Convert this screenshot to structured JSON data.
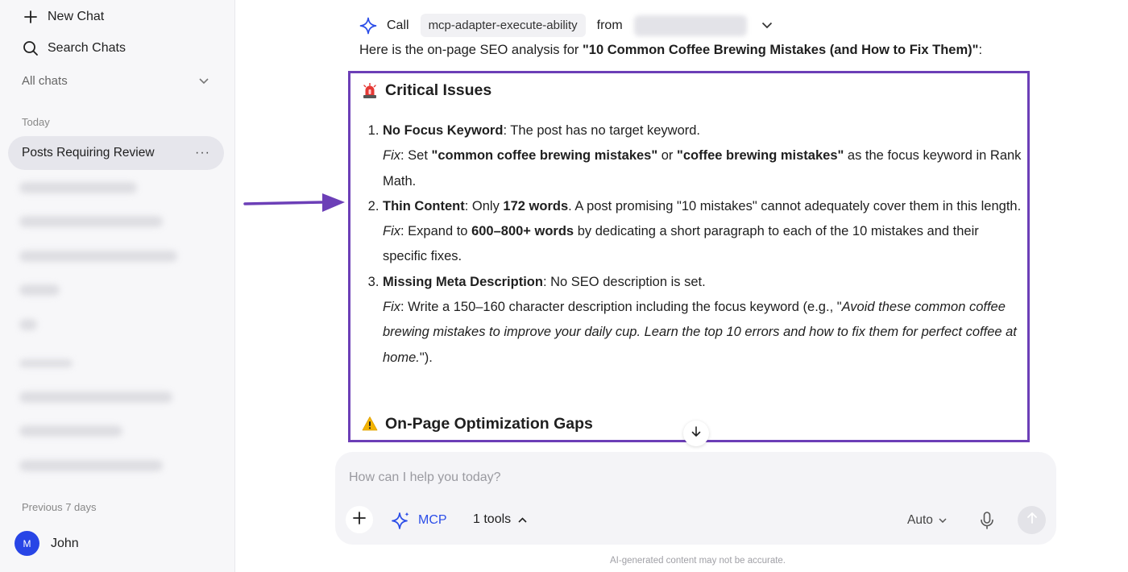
{
  "sidebar": {
    "new_chat": "New Chat",
    "search_chats": "Search Chats",
    "all_chats": "All chats",
    "section_today": "Today",
    "active_chat": "Posts Requiring Review",
    "active_chat_menu": "···",
    "section_previous": "Previous 7 days",
    "user": {
      "initial": "M",
      "name": "John"
    }
  },
  "tool_call": {
    "call_label": "Call",
    "tool_name": "mcp-adapter-execute-ability",
    "from_label": "from"
  },
  "message": {
    "intro_prefix": "Here is the on-page SEO analysis for ",
    "intro_title": "\"10 Common Coffee Brewing Mistakes (and How to Fix Them)\"",
    "intro_suffix": ":",
    "section1_title": "Critical Issues",
    "fix_label": "Fix",
    "issues": [
      {
        "title": "No Focus Keyword",
        "desc": ": The post has no target keyword.",
        "fix_a": ": Set ",
        "fix_b": "\"common coffee brewing mistakes\"",
        "fix_c": " or ",
        "fix_d": "\"coffee brewing mistakes\"",
        "fix_e": " as the focus keyword in Rank Math."
      },
      {
        "title": "Thin Content",
        "desc_a": ": Only ",
        "desc_b": "172 words",
        "desc_c": ". A post promising \"10 mistakes\" cannot adequately cover them in this length.",
        "fix_a": ": Expand to ",
        "fix_b": "600–800+ words",
        "fix_c": " by dedicating a short paragraph to each of the 10 mistakes and their specific fixes."
      },
      {
        "title": "Missing Meta Description",
        "desc": ": No SEO description is set.",
        "fix_a": ": Write a 150–160 character description including the focus keyword (e.g., \"",
        "fix_b": "Avoid these common coffee brewing mistakes to improve your daily cup. Learn the top 10 errors and how to fix them for perfect coffee at home.",
        "fix_c": "\")."
      }
    ],
    "section2_title": "On-Page Optimization Gaps"
  },
  "composer": {
    "placeholder": "How can I help you today?",
    "mcp_label": "MCP",
    "tools_label": "1 tools",
    "model": "Auto"
  },
  "disclaimer": "AI-generated content may not be accurate.",
  "colors": {
    "accent": "#2b4de8",
    "highlight_border": "#6c3fb7",
    "avatar": "#2845e6",
    "alert_red": "#e53935",
    "warning_yellow": "#f4b400"
  }
}
